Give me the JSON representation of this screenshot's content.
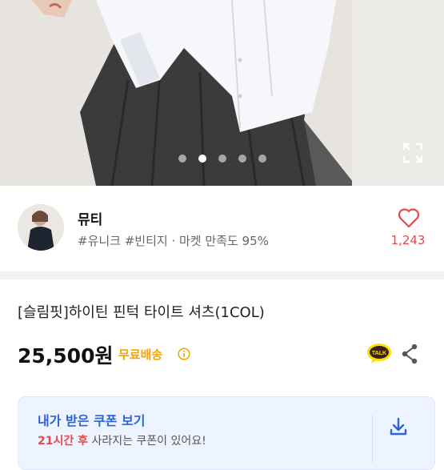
{
  "hero": {
    "carousel_total": 5,
    "carousel_active": 2,
    "expand_icon": "expand-icon"
  },
  "shop": {
    "name": "뮤티",
    "tags": "#유니크 #빈티지 · 마켓 만족도 95%",
    "likes": "1,243",
    "heart_icon": "heart-outline-icon",
    "heart_color": "#e8474c"
  },
  "product": {
    "title": "[슬림핏]하이틴 핀턱 타이트 셔츠(1COL)",
    "price": "25,500원",
    "shipping": "무료배송",
    "shipping_color": "#f0a500",
    "share_icon": "share-icon",
    "talk_icon": "kakaotalk-icon",
    "talk_label": "TALK"
  },
  "coupon": {
    "title": "내가 받은 쿠폰 보기",
    "sub_highlight": "21시간 후",
    "sub_rest": " 사라지는 쿠폰이 있어요!",
    "accent": "#2b63d9",
    "download_icon": "download-icon"
  }
}
